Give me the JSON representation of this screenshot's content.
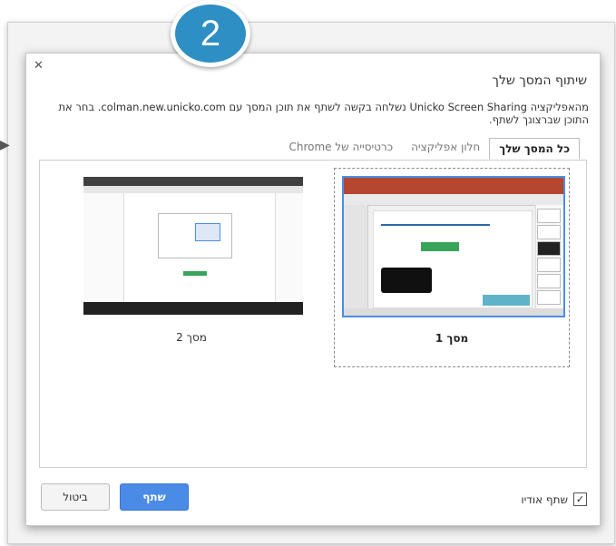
{
  "step_badge": "2",
  "dialog": {
    "title": "שיתוף המסך שלך",
    "description": "מהאפליקציה Unicko Screen Sharing נשלחה בקשה לשתף את תוכן המסך עם colman.new.unicko.com. בחר את התוכן שברצונך לשתף.",
    "close_icon": "close-icon",
    "tabs": [
      {
        "label": "כל המסך שלך",
        "active": true
      },
      {
        "label": "חלון אפליקציה",
        "active": false
      },
      {
        "label": "כרטיסייה של Chrome",
        "active": false
      }
    ],
    "screens": [
      {
        "label": "מסך 1",
        "selected": true
      },
      {
        "label": "מסך 2",
        "selected": false
      }
    ],
    "share_audio": {
      "label": "שתף אודיו",
      "checked": true
    },
    "share_button": "שתף",
    "cancel_button": "ביטול"
  },
  "colors": {
    "badge": "#2d8fc4",
    "share_button": "#4b8be8",
    "selected_border": "#4a8fe0"
  }
}
